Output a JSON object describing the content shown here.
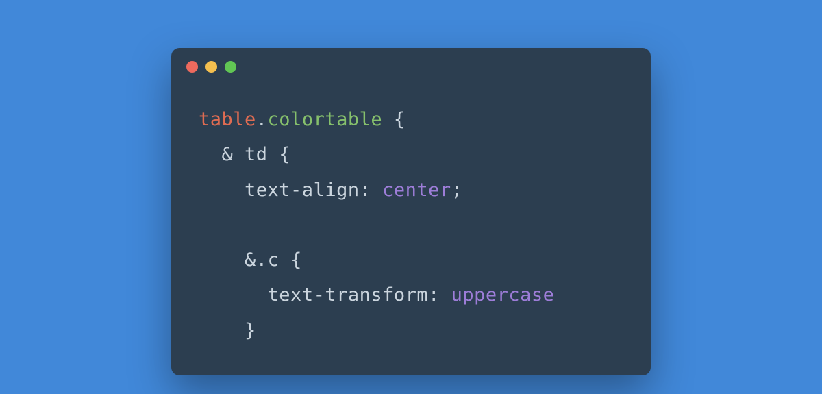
{
  "window": {
    "traffic_lights": [
      "red",
      "yellow",
      "green"
    ]
  },
  "code": {
    "line1": {
      "tag": "table",
      "dot": ".",
      "class": "colortable",
      "space_brace": " {"
    },
    "line2": {
      "indent": "  ",
      "amp": "& ",
      "nested": "td ",
      "brace": "{"
    },
    "line3": {
      "indent": "    ",
      "prop": "text-align",
      "colon": ": ",
      "value": "center",
      "semi": ";"
    },
    "line4": {
      "blank": " "
    },
    "line5": {
      "indent": "    ",
      "amp": "&",
      "dot": ".",
      "nested": "c ",
      "brace": "{"
    },
    "line6": {
      "indent": "      ",
      "prop": "text-transform",
      "colon": ": ",
      "value": "uppercase"
    },
    "line7": {
      "indent": "    ",
      "brace": "}"
    }
  }
}
